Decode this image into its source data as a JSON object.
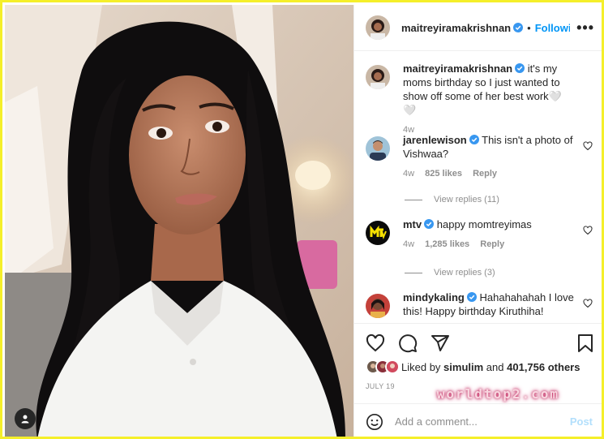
{
  "header": {
    "username": "maitreyiramakrishnan",
    "separator": "•",
    "follow_label": "Followi",
    "more_label": "•••"
  },
  "caption": {
    "username": "maitreyiramakrishnan",
    "text": "it's my moms birthday so I just wanted to show off some of her best work🤍🤍",
    "time": "4w"
  },
  "comments": [
    {
      "username": "jarenlewison",
      "text": "This isn't a photo of Vishwaa?",
      "time": "4w",
      "likes": "825 likes",
      "reply": "Reply",
      "view_replies": "View replies (11)"
    },
    {
      "username": "mtv",
      "text": "happy momtreyimas",
      "time": "4w",
      "likes": "1,285 likes",
      "reply": "Reply",
      "view_replies": "View replies (3)"
    },
    {
      "username": "mindykaling",
      "text": "Hahahahahah I love this! Happy birthday Kiruthiha!",
      "time": "",
      "likes": "",
      "reply": ""
    }
  ],
  "liked_by": {
    "prefix": "Liked by",
    "user": "simulim",
    "and": "and",
    "others": "401,756 others"
  },
  "post_date": "JULY 19",
  "add_comment": {
    "placeholder": "Add a comment...",
    "post_label": "Post"
  },
  "watermark": "worldtop2.com",
  "icons": {
    "more": "more-options-icon",
    "like": "heart-icon",
    "comment": "comment-icon",
    "share": "share-icon",
    "save": "bookmark-icon",
    "emoji": "emoji-icon",
    "tag": "user-tag-icon",
    "verified": "verified-badge-icon"
  },
  "colors": {
    "accent": "#0095f6",
    "verified": "#3897f0",
    "frame": "#f5ef2a"
  }
}
